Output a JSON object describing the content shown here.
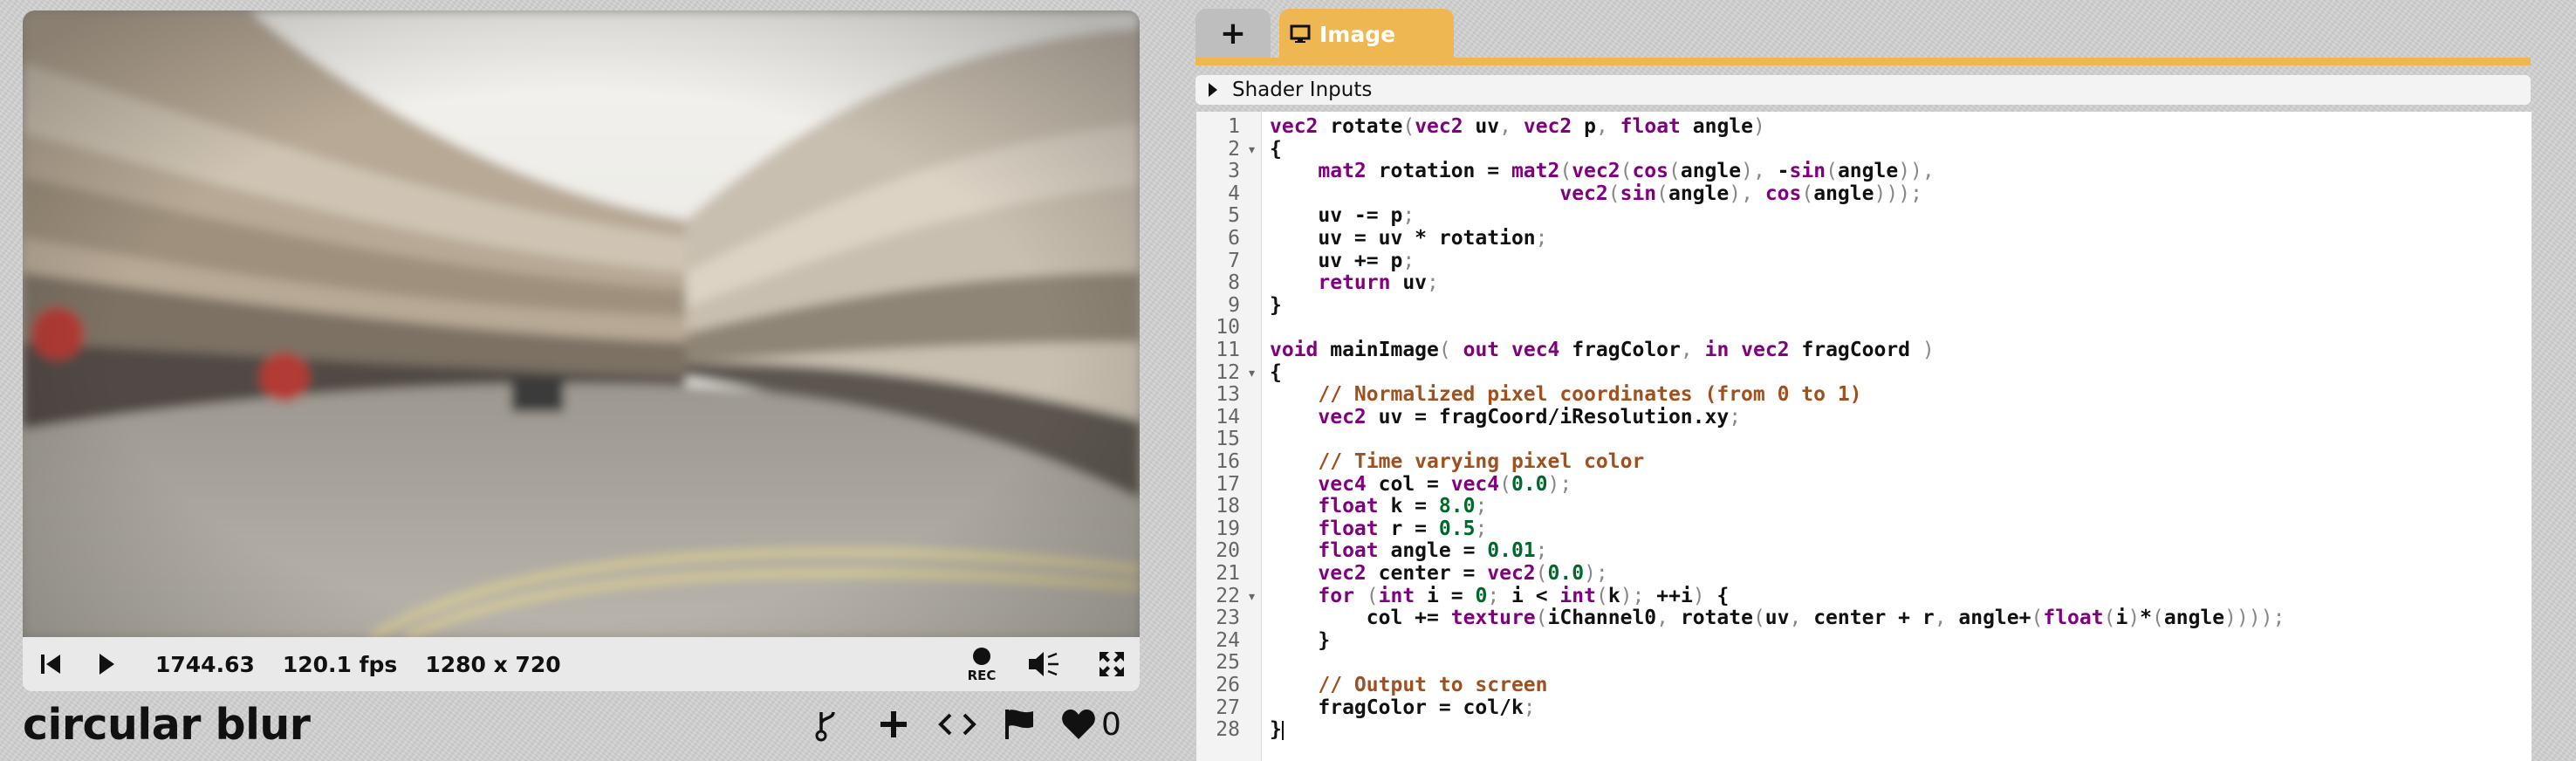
{
  "viewer": {
    "time": "1744.63",
    "fps": "120.1 fps",
    "resolution": "1280 x 720",
    "rec_label": "REC"
  },
  "shader": {
    "title": "circular blur",
    "likes": "0"
  },
  "editor": {
    "add_tab_label": "+",
    "tab_image_label": "Image",
    "shader_inputs_label": "Shader Inputs",
    "accent_color": "#efb751",
    "folded_lines": [
      2,
      12,
      22
    ],
    "code_lines": [
      "vec2 rotate(vec2 uv, vec2 p, float angle)",
      "{",
      "    mat2 rotation = mat2(vec2(cos(angle), -sin(angle)),",
      "                        vec2(sin(angle), cos(angle)));",
      "    uv -= p;",
      "    uv = uv * rotation;",
      "    uv += p;",
      "    return uv;",
      "}",
      "",
      "void mainImage( out vec4 fragColor, in vec2 fragCoord )",
      "{",
      "    // Normalized pixel coordinates (from 0 to 1)",
      "    vec2 uv = fragCoord/iResolution.xy;",
      "",
      "    // Time varying pixel color",
      "    vec4 col = vec4(0.0);",
      "    float k = 8.0;",
      "    float r = 0.5;",
      "    float angle = 0.01;",
      "    vec2 center = vec2(0.0);",
      "    for (int i = 0; i < int(k); ++i) {",
      "        col += texture(iChannel0, rotate(uv, center + r, angle+(float(i)*(angle))));",
      "    }",
      "",
      "    // Output to screen",
      "    fragColor = col/k;",
      "}"
    ]
  },
  "icons": {
    "rewind": "skip-back-icon",
    "play": "play-icon",
    "record": "record-icon",
    "volume": "volume-icon",
    "fullscreen": "fullscreen-icon",
    "fork": "fork-icon",
    "add": "plus-icon",
    "embed": "code-icon",
    "report": "flag-icon",
    "like": "heart-icon",
    "tab_image": "monitor-icon",
    "expand": "triangle-right-icon"
  }
}
